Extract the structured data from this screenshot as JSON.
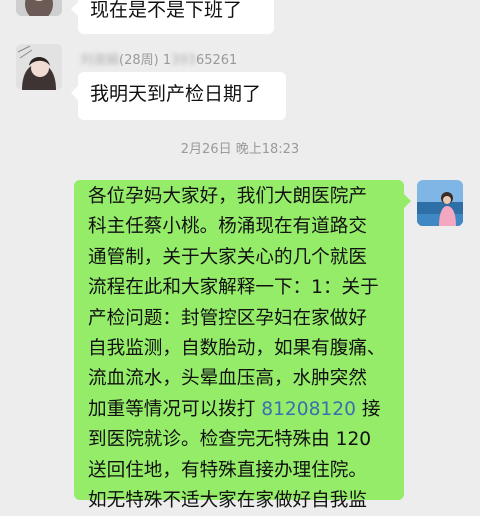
{
  "messages": [
    {
      "sender": "other",
      "text": "现在是不是下班了"
    },
    {
      "sender": "other",
      "name_suffix": "(28周) 1",
      "name_blurred": "刘淑娟",
      "phone_blurred": "393",
      "phone_tail": "65261",
      "text": "我明天到产检日期了"
    }
  ],
  "timestamp": "2月26日 晚上18:23",
  "long_message": {
    "part1": "各位孕妈大家好，我们大朗医院产\n科主任蔡小桃。杨涌现在有道路交\n通管制，关于大家关心的几个就医\n流程在此和大家解释一下：1：关于\n产检问题：封管控区孕妇在家做好\n自我监测，自数胎动，如果有腹痛、\n流血流水，头晕血压高，水肿突然\n加重等情况可以拨打 ",
    "phone": "81208120",
    "part2": " 接\n到医院就诊。检查完无特殊由 120\n送回住地，有特殊直接办理住院。\n如无特殊不适大家在家做好自我监"
  }
}
